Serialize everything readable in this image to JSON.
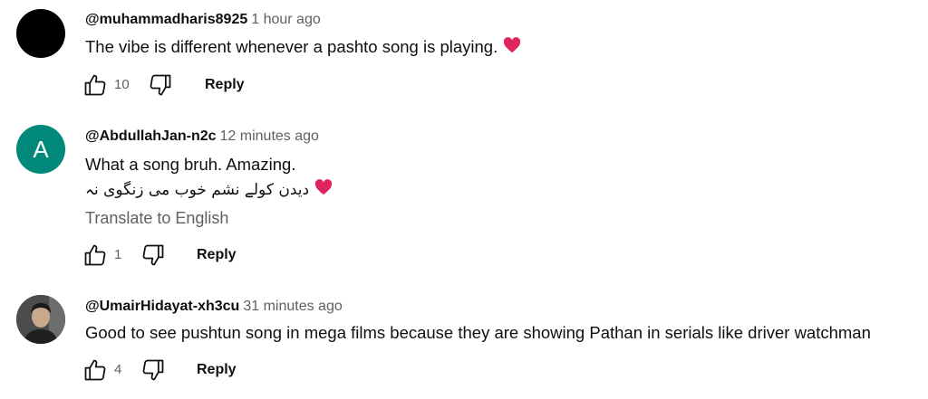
{
  "comments": [
    {
      "author": "@muhammadharis8925",
      "time": "1 hour ago",
      "avatar": {
        "type": "black"
      },
      "lines": [
        "The vibe is different whenever a pashto song is playing."
      ],
      "like_count": "10",
      "reply_label": "Reply"
    },
    {
      "author": "@AbdullahJan-n2c",
      "time": "12 minutes ago",
      "avatar": {
        "type": "letter",
        "letter": "A",
        "color": "#00897b"
      },
      "lines": [
        "What a song bruh. Amazing.",
        "دیدن کولے نشم خوب می زنگوی نہ"
      ],
      "translate_label": "Translate to English",
      "like_count": "1",
      "reply_label": "Reply"
    },
    {
      "author": "@UmairHidayat-xh3cu",
      "time": "31 minutes ago",
      "avatar": {
        "type": "photo"
      },
      "lines": [
        "Good to see pushtun song in mega films because they are showing Pathan in serials like driver watchman"
      ],
      "like_count": "4",
      "reply_label": "Reply"
    }
  ],
  "colors": {
    "primary_text": "#0f0f0f",
    "secondary_text": "#606060",
    "heart": "#e0245e"
  }
}
